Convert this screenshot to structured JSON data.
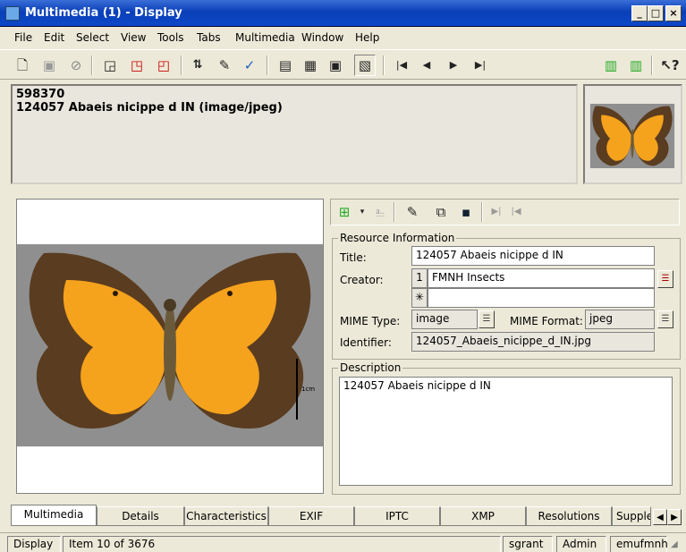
{
  "window": {
    "title": "Multimedia (1) - Display",
    "buttons": [
      "_",
      "□",
      "×"
    ]
  },
  "menu": [
    "File",
    "Edit",
    "Select",
    "View",
    "Tools",
    "Tabs",
    "Multimedia",
    "Window",
    "Help"
  ],
  "header": {
    "irn": "598370",
    "summary": "124057 Abaeis nicippe d IN (image/jpeg)"
  },
  "image": {
    "scale_label": "1cm"
  },
  "resource": {
    "group_title": "Resource Information",
    "title_label": "Title:",
    "title_value": "124057 Abaeis nicippe d IN",
    "creator_label": "Creator:",
    "creator_index": "1",
    "creator_value": "FMNH Insects",
    "creator_new_marker": "✳",
    "mime_type_label": "MIME Type:",
    "mime_type_value": "image",
    "mime_format_label": "MIME Format:",
    "mime_format_value": "jpeg",
    "identifier_label": "Identifier:",
    "identifier_value": "124057_Abaeis_nicippe_d_IN.jpg"
  },
  "description": {
    "group_title": "Description",
    "value": "124057 Abaeis nicippe d IN"
  },
  "tabs": [
    "Multimedia",
    "Details",
    "Characteristics",
    "EXIF",
    "IPTC",
    "XMP",
    "Resolutions",
    "Supple"
  ],
  "status": {
    "mode": "Display",
    "item": "Item 10 of 3676",
    "user": "sgrant",
    "group": "Admin",
    "database": "emufmnh"
  },
  "colors": {
    "wing_orange": "#f5a21c",
    "wing_border": "#5a3c20",
    "photo_bg": "#8f8f8f"
  }
}
